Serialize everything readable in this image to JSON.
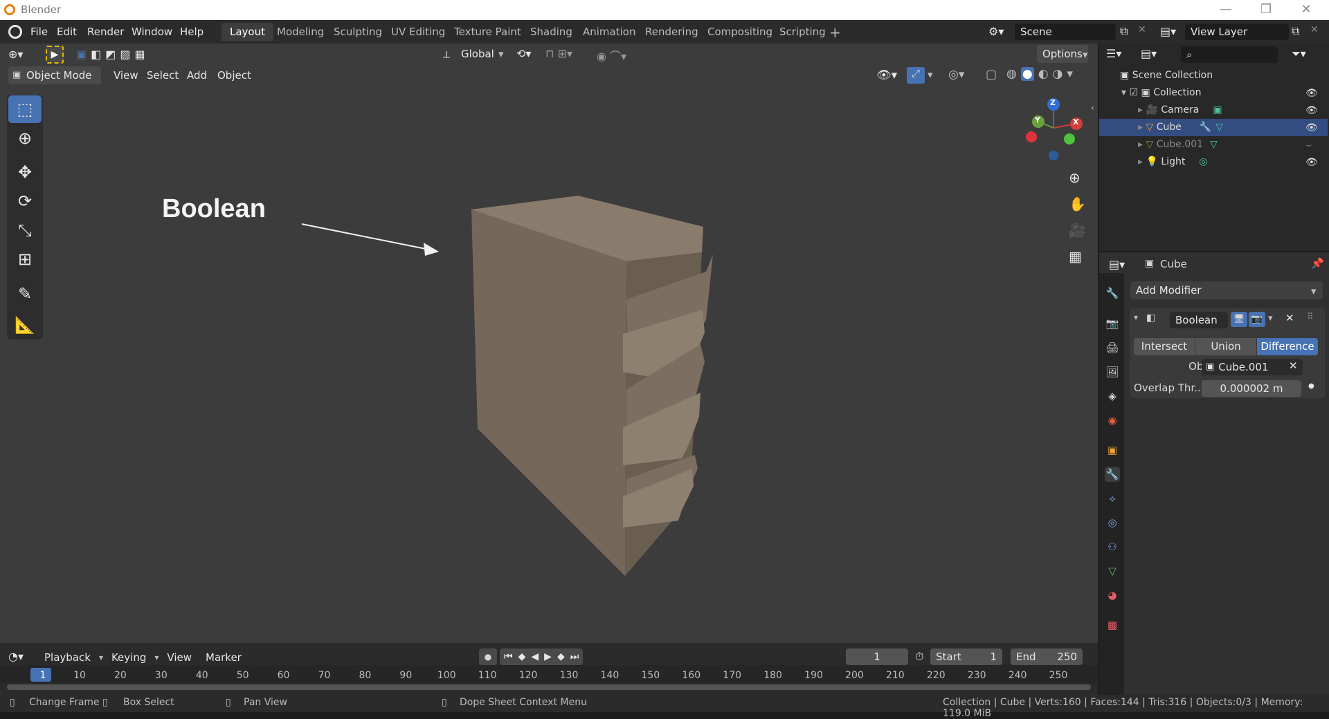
{
  "window": {
    "title": "Blender",
    "controls": {
      "minimize": "—",
      "restore": "❐",
      "close": "✕"
    }
  },
  "menubar": {
    "items": [
      "File",
      "Edit",
      "Render",
      "Window",
      "Help"
    ]
  },
  "workspaces": [
    "Layout",
    "Modeling",
    "Sculpting",
    "UV Editing",
    "Texture Paint",
    "Shading",
    "Animation",
    "Rendering",
    "Compositing",
    "Scripting"
  ],
  "active_workspace": "Layout",
  "scene": {
    "name": "Scene"
  },
  "view_layer": {
    "name": "View Layer"
  },
  "viewport": {
    "transform_orientation": "Global",
    "options_label": "Options",
    "mode": "Object Mode",
    "header_menus": [
      "View",
      "Select",
      "Add",
      "Object"
    ],
    "annotation_text": "Boolean",
    "gizmo_axes": {
      "x": "X",
      "y": "Y",
      "z": "Z"
    },
    "colors": {
      "background": "#3c3c3c",
      "object": "#7f7060",
      "accent": "#4772b3"
    }
  },
  "outliner": {
    "root": "Scene Collection",
    "collection": "Collection",
    "items": [
      {
        "name": "Camera",
        "selected": false,
        "visible": true
      },
      {
        "name": "Cube",
        "selected": true,
        "visible": true
      },
      {
        "name": "Cube.001",
        "selected": false,
        "visible": false
      },
      {
        "name": "Light",
        "selected": false,
        "visible": true
      }
    ]
  },
  "properties": {
    "object_name": "Cube",
    "add_modifier_label": "Add Modifier",
    "modifier": {
      "name": "Boolean",
      "operations": [
        "Intersect",
        "Union",
        "Difference"
      ],
      "active_operation": "Difference",
      "object_label": "Object",
      "object_value": "Cube.001",
      "overlap_label": "Overlap Thr...",
      "overlap_value": "0.000002 m"
    }
  },
  "timeline": {
    "menus": [
      "Playback",
      "Keying",
      "View",
      "Marker"
    ],
    "current_frame": "1",
    "start_label": "Start",
    "start_value": "1",
    "end_label": "End",
    "end_value": "250",
    "ruler_ticks": [
      "1",
      "10",
      "20",
      "30",
      "40",
      "50",
      "60",
      "70",
      "80",
      "90",
      "100",
      "110",
      "120",
      "130",
      "140",
      "150",
      "160",
      "170",
      "180",
      "190",
      "200",
      "210",
      "220",
      "230",
      "240",
      "250"
    ]
  },
  "statusbar": {
    "hints": [
      "Change Frame",
      "Box Select",
      "Pan View",
      "Dope Sheet Context Menu"
    ],
    "stats": "Collection | Cube | Verts:160 | Faces:144 | Tris:316 | Objects:0/3 | Memory: 119.0 MiB"
  }
}
